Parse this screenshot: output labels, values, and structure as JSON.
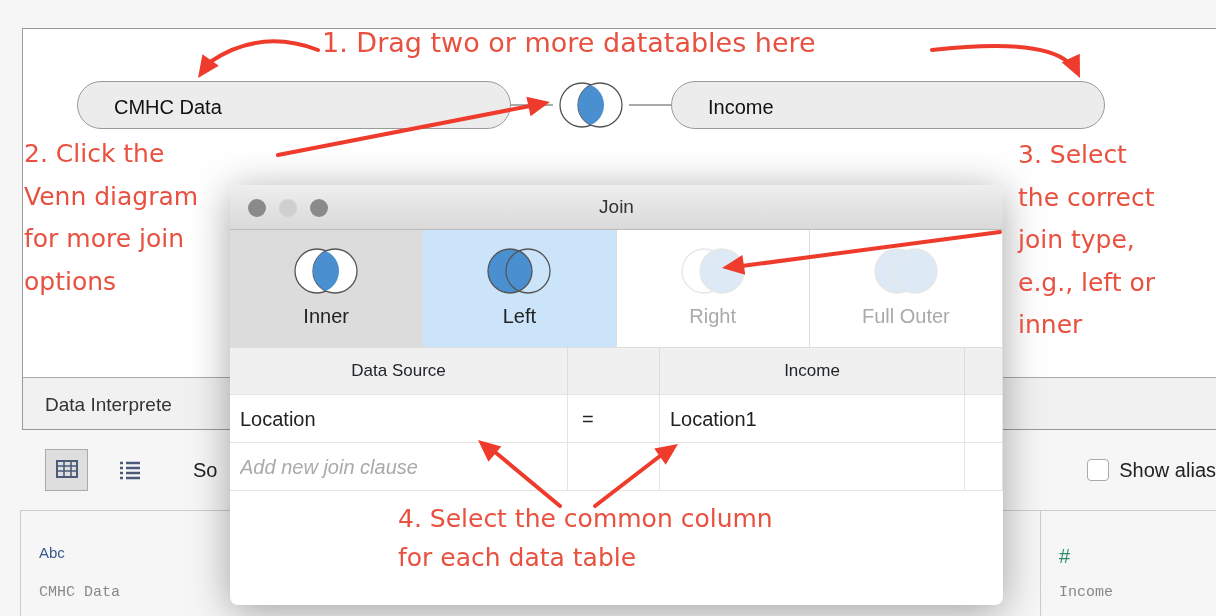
{
  "annotations": [
    {
      "text": "1. Drag two or more datatables here"
    },
    {
      "text": "2. Click the\nVenn diagram\nfor more join\noptions"
    },
    {
      "text": "3. Select\nthe correct\njoin type,\ne.g., left or\ninner"
    },
    {
      "text": "4. Select the common column\nfor each data table"
    }
  ],
  "join_canvas": {
    "tables": [
      {
        "name": "CMHC Data"
      },
      {
        "name": "Income"
      }
    ],
    "join": {
      "kind": "inner"
    }
  },
  "data_interpreter": {
    "label": "Data Interprete"
  },
  "toolbar": {
    "views": [
      {
        "kind": "grid",
        "selected": true
      },
      {
        "kind": "list",
        "selected": false
      }
    ],
    "sort_label": "So",
    "show_aliases": {
      "label": "Show alias",
      "checked": false
    }
  },
  "columns": [
    {
      "kind": "string",
      "type_label": "Abc",
      "source": "CMHC Data"
    },
    {
      "kind": "number",
      "type_label": "#",
      "source": "Income"
    }
  ],
  "join_dialog": {
    "title": "Join",
    "join_types": [
      {
        "kind": "inner",
        "label": "Inner",
        "selected": false,
        "highlighted": true,
        "disabled": false
      },
      {
        "kind": "left",
        "label": "Left",
        "selected": true,
        "highlighted": false,
        "disabled": false
      },
      {
        "kind": "right",
        "label": "Right",
        "selected": false,
        "highlighted": false,
        "disabled": true
      },
      {
        "kind": "full",
        "label": "Full Outer",
        "selected": false,
        "highlighted": false,
        "disabled": true
      }
    ],
    "headers": [
      "Data Source",
      "Income"
    ],
    "clauses": [
      {
        "left": "Location",
        "operator": "=",
        "right": "Location1"
      }
    ],
    "add_clause_placeholder": "Add new join clause"
  }
}
